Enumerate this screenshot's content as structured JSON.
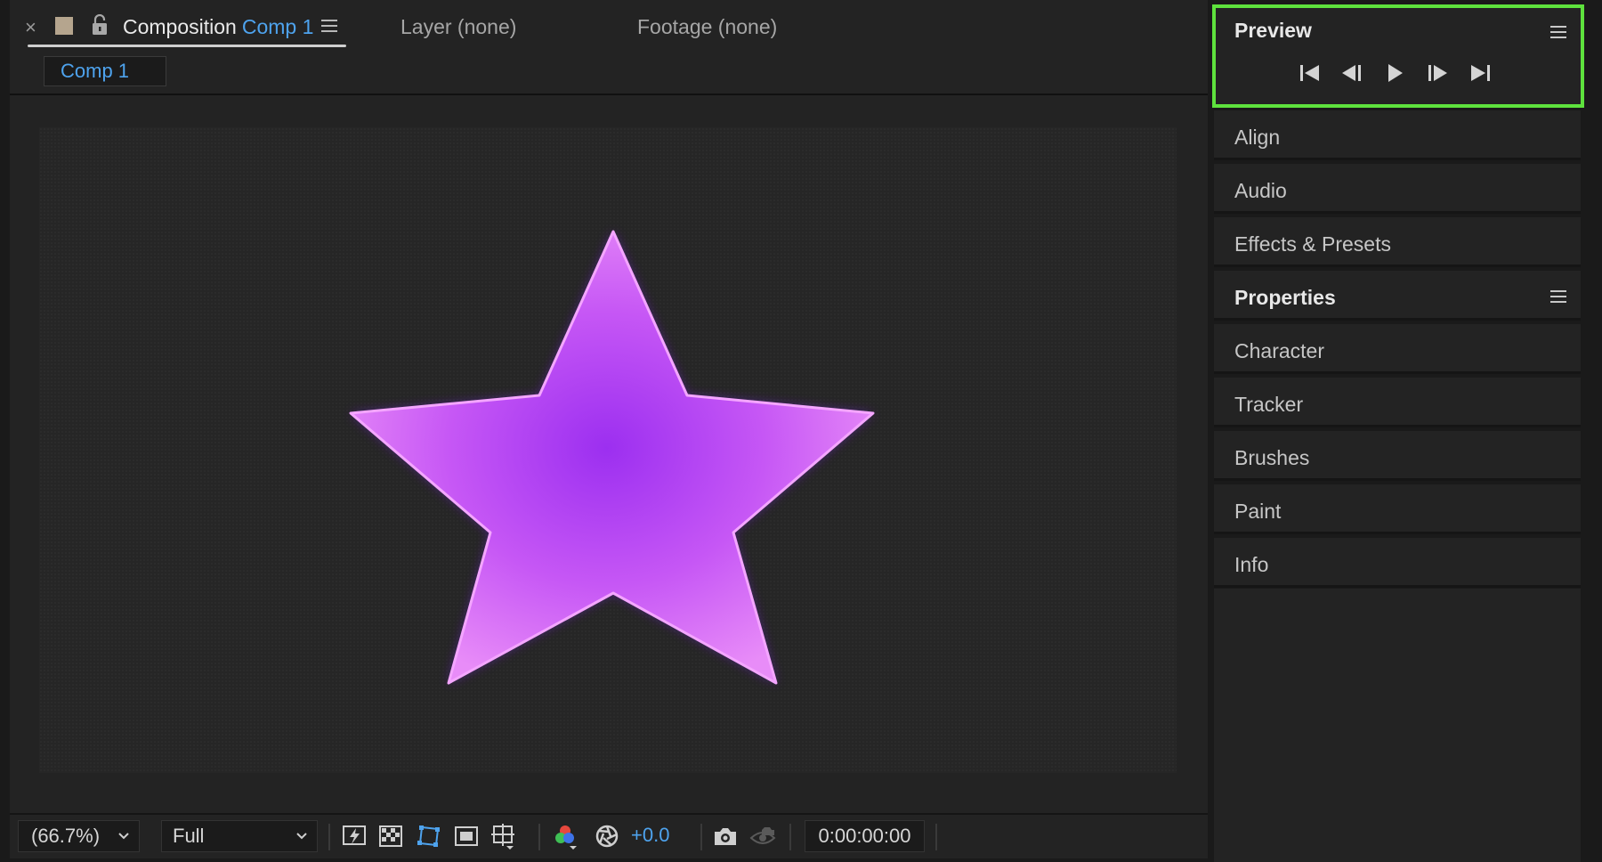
{
  "composition_tab": {
    "close_glyph": "×",
    "title_prefix": "Composition",
    "title_name": "Comp 1",
    "layer_tab": "Layer (none)",
    "footage_tab": "Footage (none)",
    "subtab": "Comp 1",
    "swatch_color": "#b5a58e"
  },
  "viewer": {
    "content": "purple-star-shape",
    "star_colors": {
      "center": "#9c2ff0",
      "mid": "#c657f5",
      "edge": "#e88cf8"
    }
  },
  "toolbar": {
    "zoom": "(66.7%)",
    "resolution": "Full",
    "exposure": "+0.0",
    "timecode": "0:00:00:00",
    "icons": [
      "fast-previews-icon",
      "transparency-grid-icon",
      "mask-path-visibility-icon",
      "region-of-interest-icon",
      "grid-guides-icon",
      "rgb-channels-icon",
      "reset-exposure-icon",
      "snapshot-icon",
      "show-snapshot-icon"
    ]
  },
  "right_panels": {
    "preview": {
      "title": "Preview",
      "controls": [
        "first-frame-button",
        "previous-frame-button",
        "play-button",
        "next-frame-button",
        "last-frame-button"
      ],
      "highlight_color": "#5ee23d"
    },
    "items": [
      {
        "label": "Align"
      },
      {
        "label": "Audio"
      },
      {
        "label": "Effects & Presets"
      },
      {
        "label": "Properties"
      },
      {
        "label": "Character"
      },
      {
        "label": "Tracker"
      },
      {
        "label": "Brushes"
      },
      {
        "label": "Paint"
      },
      {
        "label": "Info"
      }
    ]
  },
  "accent_color": "#4ea3ee"
}
